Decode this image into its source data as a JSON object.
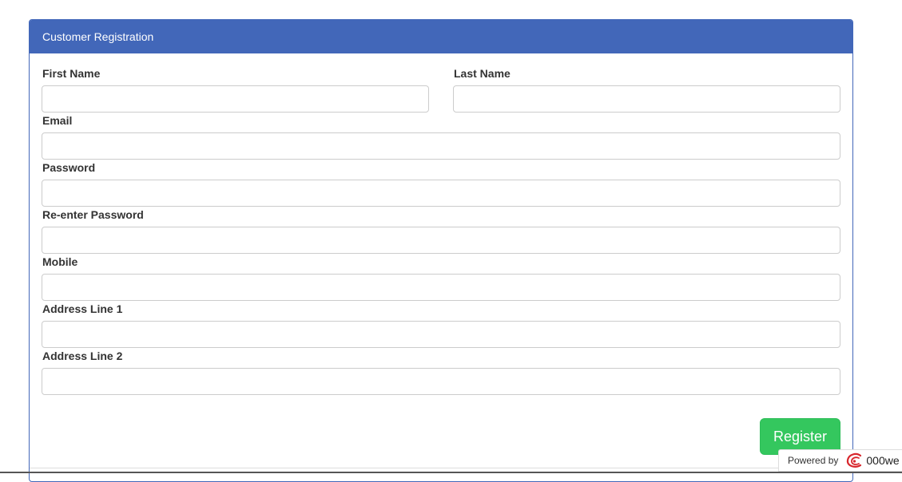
{
  "panel": {
    "title": "Customer Registration"
  },
  "form": {
    "first_name": {
      "label": "First Name",
      "value": "",
      "placeholder": ""
    },
    "last_name": {
      "label": "Last Name",
      "value": "",
      "placeholder": ""
    },
    "email": {
      "label": "Email",
      "value": "",
      "placeholder": ""
    },
    "password": {
      "label": "Password",
      "value": "",
      "placeholder": ""
    },
    "reenter_password": {
      "label": "Re-enter Password",
      "value": "",
      "placeholder": ""
    },
    "mobile": {
      "label": "Mobile",
      "value": "",
      "placeholder": ""
    },
    "address1": {
      "label": "Address Line 1",
      "value": "",
      "placeholder": ""
    },
    "address2": {
      "label": "Address Line 2",
      "value": "",
      "placeholder": ""
    },
    "submit_label": "Register"
  },
  "footer_badge": {
    "prefix": "Powered by",
    "brand": "000we",
    "logo_icon": "000webhost-logo-icon"
  },
  "colors": {
    "header": "#4267b9",
    "button": "#34c75e",
    "text": "#333333",
    "logo": "#d8262c"
  }
}
